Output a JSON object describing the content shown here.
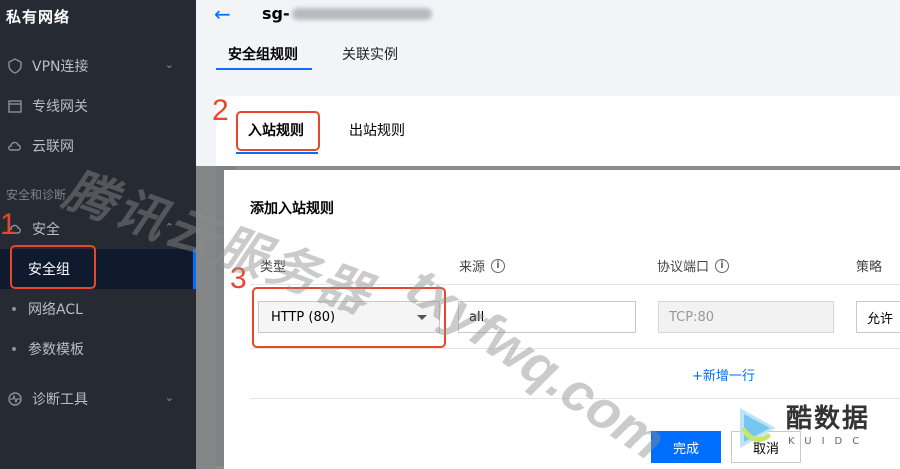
{
  "sidebar": {
    "brand": "私有网络",
    "items": [
      {
        "label": "VPN连接",
        "icon": "shield-icon"
      },
      {
        "label": "专线网关",
        "icon": "calendar-icon"
      },
      {
        "label": "云联网",
        "icon": "cloud-icon"
      }
    ],
    "section": "安全和诊断",
    "security": {
      "label": "安全",
      "icon": "cloud-icon"
    },
    "security_items": [
      {
        "label": "安全组"
      },
      {
        "label": "网络ACL"
      },
      {
        "label": "参数模板"
      }
    ],
    "diag": {
      "label": "诊断工具",
      "icon": "diagnose-icon"
    }
  },
  "header": {
    "title_prefix": "sg-",
    "tabs": [
      "安全组规则",
      "关联实例"
    ]
  },
  "rules": {
    "tabs": [
      "入站规则",
      "出站规则"
    ]
  },
  "modal": {
    "title": "添加入站规则",
    "columns": {
      "type": "类型",
      "source": "来源",
      "port": "协议端口",
      "policy": "策略"
    },
    "type_value": "HTTP (80)",
    "source_value": "all",
    "port_placeholder": "TCP:80",
    "policy_value": "允许",
    "add_row": "+新增一行",
    "ok": "完成",
    "cancel": "取消"
  },
  "annotations": [
    "1",
    "2",
    "3"
  ],
  "watermarks": {
    "cn": "腾讯云服务器",
    "url": "txyfwq.com",
    "logo": "酷数据",
    "logo_sub": "KUIDC"
  },
  "colors": {
    "accent": "#006eff",
    "annotation": "#e8472a",
    "sidebar": "#252a33"
  }
}
